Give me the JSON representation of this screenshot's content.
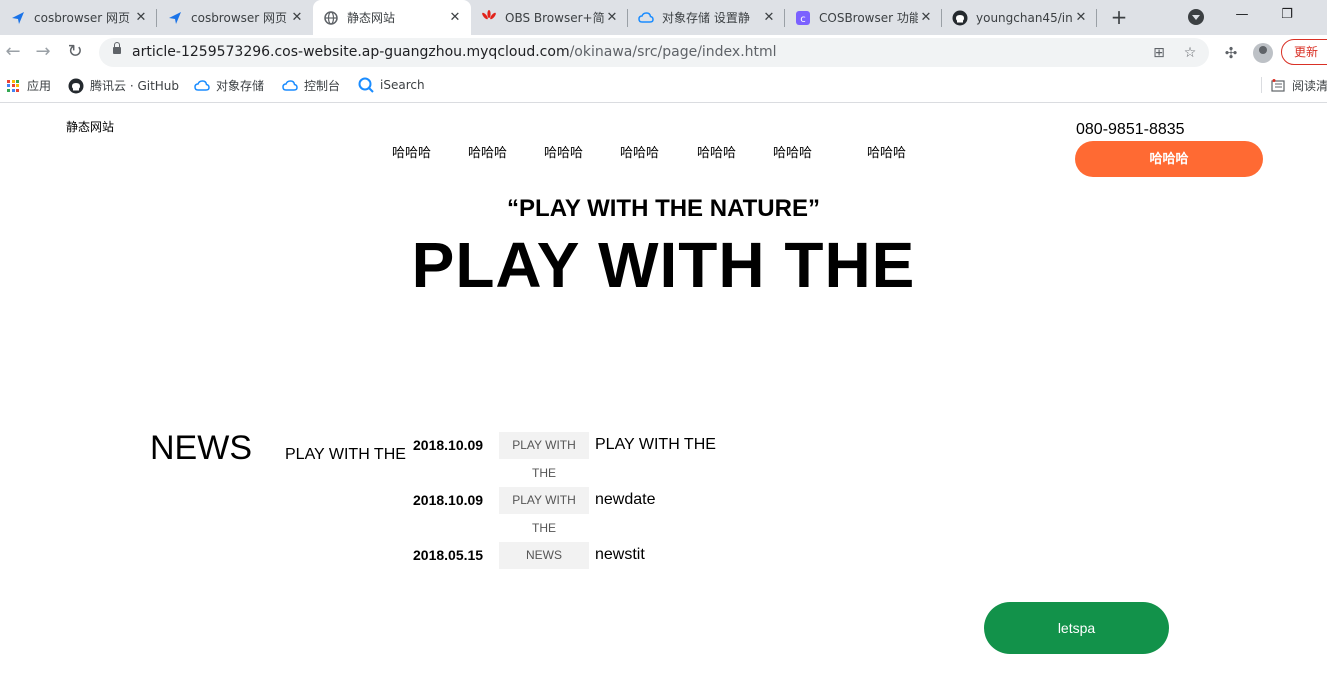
{
  "browser": {
    "tabs": [
      {
        "title": "cosbrowser 网页",
        "icon": "cos-arrow-icon",
        "active": false
      },
      {
        "title": "cosbrowser 网页",
        "icon": "cos-arrow-icon",
        "active": false
      },
      {
        "title": "静态网站",
        "icon": "globe-icon",
        "active": true
      },
      {
        "title": "OBS Browser+简",
        "icon": "huawei-icon",
        "active": false
      },
      {
        "title": "对象存储 设置静",
        "icon": "cloud-icon",
        "active": false
      },
      {
        "title": "COSBrowser 功能",
        "icon": "cos-square-icon",
        "active": false
      },
      {
        "title": "youngchan45/in",
        "icon": "github-icon",
        "active": false
      }
    ],
    "new_tab": "+",
    "url_host": "article-1259573296.cos-website.ap-guangzhou.myqcloud.com",
    "url_path": "/okinawa/src/page/index.html",
    "update_label": "更新",
    "bookmarks": [
      {
        "label": "应用",
        "icon": "apps-grid-icon"
      },
      {
        "label": "腾讯云 · GitHub",
        "icon": "github-icon"
      },
      {
        "label": "对象存储",
        "icon": "cloud-icon"
      },
      {
        "label": "控制台",
        "icon": "cloud-icon"
      },
      {
        "label": "iSearch",
        "icon": "isearch-icon"
      }
    ],
    "reading_list": "阅读清"
  },
  "site": {
    "logo": "静态网站",
    "nav": [
      "哈哈哈",
      "哈哈哈",
      "哈哈哈",
      "哈哈哈",
      "哈哈哈",
      "哈哈哈",
      "哈哈哈"
    ],
    "phone": "080-9851-8835",
    "cta_label": "哈哈哈",
    "tagline": "“PLAY WITH THE NATURE”",
    "hero": "PLAY WITH THE",
    "news_heading": "NEWS",
    "news_sub": "PLAY WITH THE",
    "news": [
      {
        "date": "2018.10.09",
        "tag": "PLAY WITH",
        "tag2": "THE",
        "title": "PLAY WITH THE"
      },
      {
        "date": "2018.10.09",
        "tag": "PLAY WITH",
        "tag2": "THE",
        "title": "newdate"
      },
      {
        "date": "2018.05.15",
        "tag": "NEWS",
        "tag2": "",
        "title": "newstit"
      }
    ],
    "letspa_label": "letspa"
  },
  "colors": {
    "cta_orange": "#ff6a33",
    "button_green": "#12924a",
    "update_red": "#d93025",
    "tabstrip": "#dee1e6"
  }
}
